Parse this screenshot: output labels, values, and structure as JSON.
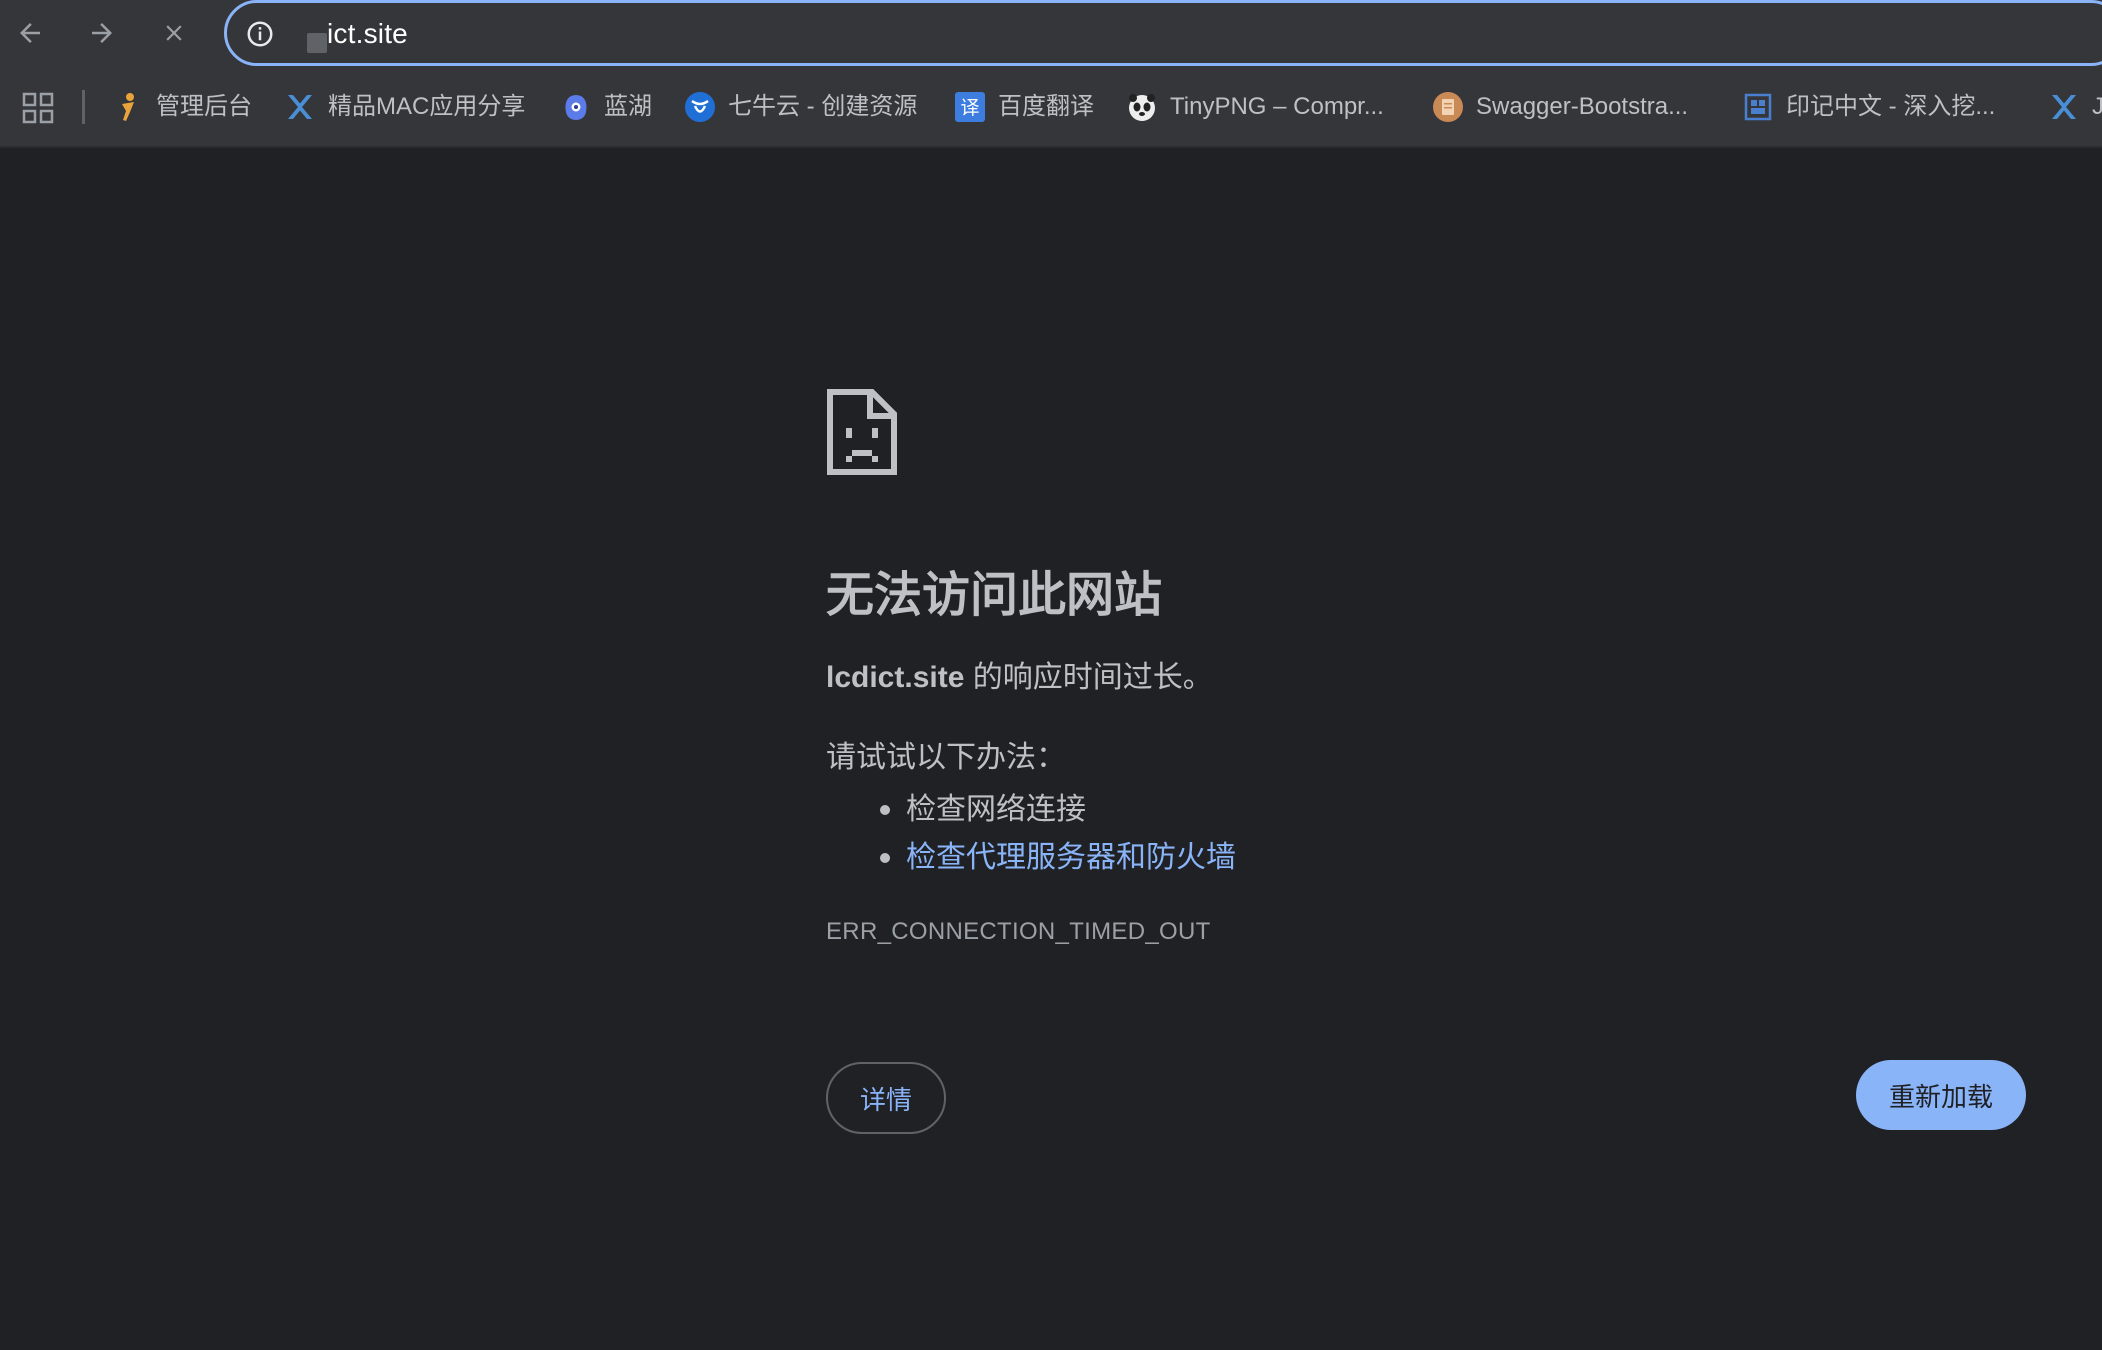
{
  "toolbar": {
    "back_icon": "back-arrow-icon",
    "forward_icon": "forward-arrow-icon",
    "stop_icon": "close-icon",
    "address": "ict.site",
    "info_icon": "info-icon"
  },
  "bookmarks": {
    "apps_icon": "apps-grid-icon",
    "items": [
      {
        "label": "管理后台",
        "icon": "orange-figure-icon",
        "color": "#e8a33d"
      },
      {
        "label": "精品MAC应用分享",
        "icon": "x-logo-icon",
        "color": "#4a8fd6"
      },
      {
        "label": "蓝湖",
        "icon": "lanhu-icon",
        "color": "#5b7be9"
      },
      {
        "label": "七牛云 - 创建资源",
        "icon": "qiniu-icon",
        "color": "#1f6fd6"
      },
      {
        "label": "百度翻译",
        "icon": "translate-icon",
        "color": "#3d7de0"
      },
      {
        "label": "TinyPNG – Compr...",
        "icon": "panda-icon",
        "color": "#cccccc"
      },
      {
        "label": "Swagger-Bootstra...",
        "icon": "document-icon",
        "color": "#c98a55"
      },
      {
        "label": "印记中文 - 深入挖...",
        "icon": "yinji-icon",
        "color": "#4a7fd0"
      },
      {
        "label": "J",
        "icon": "x-logo-icon",
        "color": "#4a8fd6"
      }
    ]
  },
  "error": {
    "icon": "sad-document-icon",
    "title": "无法访问此网站",
    "domain": "lcdict.site",
    "summary_suffix": " 的响应时间过长。",
    "suggest_heading": "请试试以下办法：",
    "suggestions": [
      {
        "text": "检查网络连接",
        "is_link": false
      },
      {
        "text": "检查代理服务器和防火墙",
        "is_link": true
      }
    ],
    "code": "ERR_CONNECTION_TIMED_OUT",
    "details_label": "详情",
    "reload_label": "重新加载"
  },
  "colors": {
    "background": "#202124",
    "toolbar": "#35363a",
    "accent": "#8ab4f8",
    "text": "#bdc1c6"
  }
}
